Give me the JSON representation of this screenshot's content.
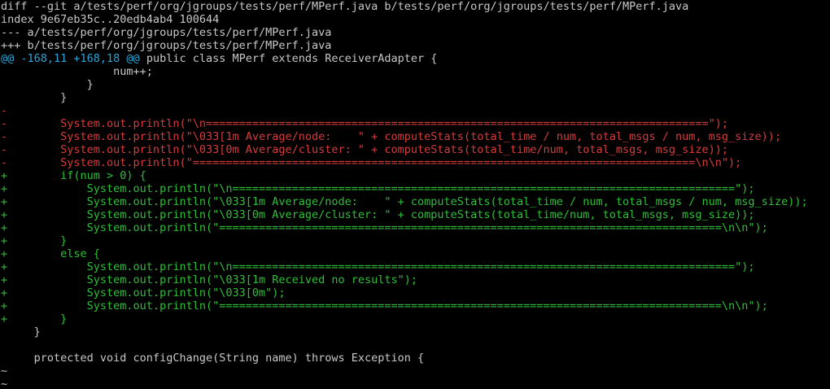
{
  "colors": {
    "background": "#000000",
    "context": "#c8c8c8",
    "deletion": "#d53c3c",
    "addition": "#2fbf39",
    "hunk_header": "#2aa7d8"
  },
  "lines": [
    {
      "type": "header",
      "text": "diff --git a/tests/perf/org/jgroups/tests/perf/MPerf.java b/tests/perf/org/jgroups/tests/perf/MPerf.java"
    },
    {
      "type": "header",
      "text": "index 9e67eb35c..20edb4ab4 100644"
    },
    {
      "type": "header",
      "text": "--- a/tests/perf/org/jgroups/tests/perf/MPerf.java"
    },
    {
      "type": "header",
      "text": "+++ b/tests/perf/org/jgroups/tests/perf/MPerf.java"
    },
    {
      "type": "hunk",
      "hunk": "@@ -168,11 +168,18 @@",
      "text": " public class MPerf extends ReceiverAdapter {"
    },
    {
      "type": "context",
      "text": "                 num++;"
    },
    {
      "type": "context",
      "text": "             }"
    },
    {
      "type": "context",
      "text": "         }"
    },
    {
      "type": "deletion",
      "text": "-"
    },
    {
      "type": "deletion",
      "text": "-        System.out.println(\"\\n============================================================================\");"
    },
    {
      "type": "deletion",
      "text": "-        System.out.println(\"\\033[1m Average/node:    \" + computeStats(total_time / num, total_msgs / num, msg_size));"
    },
    {
      "type": "deletion",
      "text": "-        System.out.println(\"\\033[0m Average/cluster: \" + computeStats(total_time/num, total_msgs, msg_size));"
    },
    {
      "type": "deletion",
      "text": "-        System.out.println(\"============================================================================\\n\\n\");"
    },
    {
      "type": "addition",
      "text": "+        if(num > 0) {"
    },
    {
      "type": "addition",
      "text": "+            System.out.println(\"\\n============================================================================\");"
    },
    {
      "type": "addition",
      "text": "+            System.out.println(\"\\033[1m Average/node:    \" + computeStats(total_time / num, total_msgs / num, msg_size));"
    },
    {
      "type": "addition",
      "text": "+            System.out.println(\"\\033[0m Average/cluster: \" + computeStats(total_time/num, total_msgs, msg_size));"
    },
    {
      "type": "addition",
      "text": "+            System.out.println(\"============================================================================\\n\\n\");"
    },
    {
      "type": "addition",
      "text": "+        }"
    },
    {
      "type": "addition",
      "text": "+        else {"
    },
    {
      "type": "addition",
      "text": "+            System.out.println(\"\\n============================================================================\");"
    },
    {
      "type": "addition",
      "text": "+            System.out.println(\"\\033[1m Received no results\");"
    },
    {
      "type": "addition",
      "text": "+            System.out.println(\"\\033[0m\");"
    },
    {
      "type": "addition",
      "text": "+            System.out.println(\"============================================================================\\n\\n\");"
    },
    {
      "type": "addition",
      "text": "+        }"
    },
    {
      "type": "context",
      "text": "     }"
    },
    {
      "type": "context",
      "text": ""
    },
    {
      "type": "context",
      "text": "     protected void configChange(String name) throws Exception {"
    },
    {
      "type": "tilde",
      "text": "~"
    },
    {
      "type": "tilde",
      "text": "~"
    }
  ]
}
